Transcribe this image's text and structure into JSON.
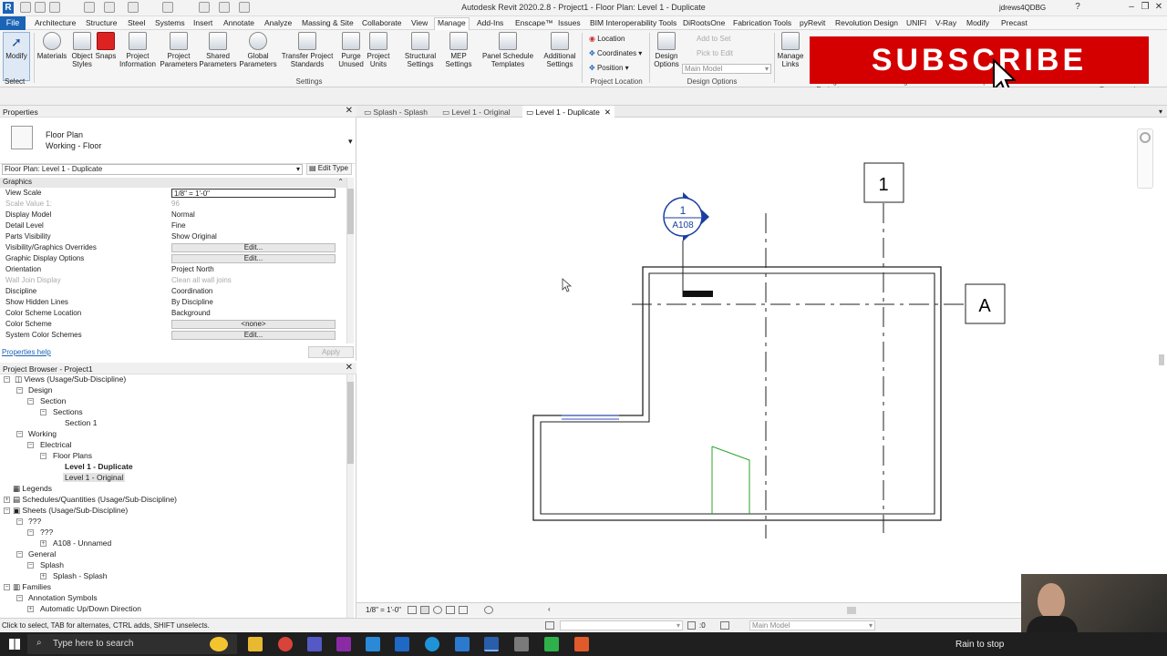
{
  "window": {
    "title": "Autodesk Revit 2020.2.8 - Project1 - Floor Plan: Level 1 - Duplicate",
    "user": "jdrews4QDBG"
  },
  "menu": [
    "File",
    "Architecture",
    "Structure",
    "Steel",
    "Systems",
    "Insert",
    "Annotate",
    "Analyze",
    "Massing & Site",
    "Collaborate",
    "View",
    "Manage",
    "Add-Ins",
    "Enscape™",
    "Issues",
    "BIM Interoperability Tools",
    "DiRootsOne",
    "Fabrication Tools",
    "pyRevit",
    "Revolution Design",
    "UNIFI",
    "V-Ray",
    "Modify",
    "Precast"
  ],
  "ribbon": {
    "select_label": "Select",
    "modify": "Modify",
    "buttons": [
      {
        "label": "Materials"
      },
      {
        "label": "Object Styles"
      },
      {
        "label": "Snaps"
      },
      {
        "label": "Project Information"
      },
      {
        "label": "Project Parameters"
      },
      {
        "label": "Shared Parameters"
      },
      {
        "label": "Global Parameters"
      },
      {
        "label": "Transfer Project Standards"
      },
      {
        "label": "Purge Unused"
      },
      {
        "label": "Project Units"
      },
      {
        "label": "Structural Settings"
      },
      {
        "label": "MEP Settings"
      },
      {
        "label": "Panel Schedule Templates"
      },
      {
        "label": "Additional Settings"
      }
    ],
    "settings_label": "Settings",
    "location": {
      "items": [
        "Location",
        "Coordinates",
        "Position"
      ],
      "label": "Project Location"
    },
    "design_options": {
      "button": "Design Options",
      "main_model": "Main Model",
      "add_to_set": "Add to Set",
      "pick_to_edit": "Pick to Edit",
      "label": "Design Options"
    },
    "manage_links": "Manage Links",
    "right_panels": [
      "Manage Project",
      "Phasing",
      "Selection",
      "Inquiry",
      "Macros",
      "Visual Programming"
    ]
  },
  "subscribe": "SUBSCRIBE",
  "properties": {
    "header": "Properties",
    "family": "Floor Plan",
    "type": "Working - Floor",
    "instance": "Floor Plan: Level 1 - Duplicate",
    "edit_type": "Edit Type",
    "group": "Graphics",
    "rows": [
      {
        "k": "View Scale",
        "v": "1/8\" = 1'-0\""
      },
      {
        "k": "Scale Value    1:",
        "v": "96"
      },
      {
        "k": "Display Model",
        "v": "Normal"
      },
      {
        "k": "Detail Level",
        "v": "Fine"
      },
      {
        "k": "Parts Visibility",
        "v": "Show Original"
      },
      {
        "k": "Visibility/Graphics Overrides",
        "v": "Edit..."
      },
      {
        "k": "Graphic Display Options",
        "v": "Edit..."
      },
      {
        "k": "Orientation",
        "v": "Project North"
      },
      {
        "k": "Wall Join Display",
        "v": "Clean all wall joins"
      },
      {
        "k": "Discipline",
        "v": "Coordination"
      },
      {
        "k": "Show Hidden Lines",
        "v": "By Discipline"
      },
      {
        "k": "Color Scheme Location",
        "v": "Background"
      },
      {
        "k": "Color Scheme",
        "v": "<none>"
      },
      {
        "k": "System Color Schemes",
        "v": "Edit..."
      }
    ],
    "help": "Properties help",
    "apply": "Apply"
  },
  "browser": {
    "header": "Project Browser - Project1",
    "items": [
      {
        "t": "Views (Usage/Sub-Discipline)"
      },
      {
        "t": "Design"
      },
      {
        "t": "Section"
      },
      {
        "t": "Sections"
      },
      {
        "t": "Section 1"
      },
      {
        "t": "Working"
      },
      {
        "t": "Electrical"
      },
      {
        "t": "Floor Plans"
      },
      {
        "t": "Level 1 - Duplicate"
      },
      {
        "t": "Level 1 - Original"
      },
      {
        "t": "Legends"
      },
      {
        "t": "Schedules/Quantities (Usage/Sub-Discipline)"
      },
      {
        "t": "Sheets (Usage/Sub-Discipline)"
      },
      {
        "t": "???"
      },
      {
        "t": "???"
      },
      {
        "t": "A108 - Unnamed"
      },
      {
        "t": "General"
      },
      {
        "t": "Splash"
      },
      {
        "t": "Splash - Splash"
      },
      {
        "t": "Families"
      },
      {
        "t": "Annotation Symbols"
      },
      {
        "t": "Automatic Up/Down Direction"
      }
    ]
  },
  "tabs": [
    "Splash - Splash",
    "Level 1 - Original",
    "Level 1 - Duplicate"
  ],
  "drawing": {
    "grid_1": "1",
    "grid_a": "A",
    "elev_num": "1",
    "elev_sheet": "A108"
  },
  "viewbar": {
    "scale": "1/8\" = 1'-0\""
  },
  "status": {
    "hint": "Click to select, TAB for alternates, CTRL adds, SHIFT unselects.",
    "workset": ":0",
    "model": "Main Model"
  },
  "taskbar": {
    "search": "Type here to search",
    "weather": "Rain to stop"
  }
}
